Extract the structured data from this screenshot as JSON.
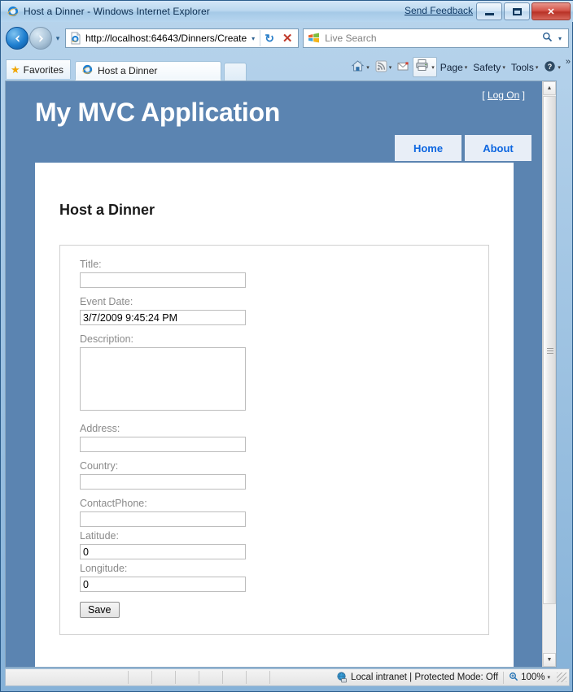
{
  "window": {
    "title": "Host a Dinner - Windows Internet Explorer",
    "send_feedback": "Send Feedback",
    "minimize_label": "Minimize",
    "maximize_label": "Maximize",
    "close_label": "Close",
    "ie_icon": "internet-explorer-icon"
  },
  "nav": {
    "back_label": "Back",
    "forward_label": "Forward",
    "back_glyph": "←",
    "forward_glyph": "→",
    "history_glyph": "▾",
    "address": {
      "url": "http://localhost:64643/Dinners/Create",
      "page_icon": "page-document-icon",
      "dropdown_glyph": "▾",
      "refresh_glyph": "↻",
      "refresh_label": "Refresh",
      "stop_glyph": "✕",
      "stop_label": "Stop"
    },
    "search": {
      "placeholder": "Live Search",
      "provider_icon": "windows-logo-icon",
      "magnifier_glyph": "⌕",
      "dropdown_glyph": "▾"
    }
  },
  "commandbar": {
    "favorites_label": "Favorites",
    "favorites_icon": "star-icon",
    "tab_label": "Host a Dinner",
    "tab_icon": "internet-explorer-icon",
    "new_tab_label": "New Tab",
    "items": [
      {
        "label": "",
        "icon": "home-icon",
        "caret": "▾"
      },
      {
        "label": "",
        "icon": "rss-feed-icon",
        "caret": "▾"
      },
      {
        "label": "",
        "icon": "mail-icon",
        "caret": ""
      },
      {
        "label": "",
        "icon": "printer-icon",
        "caret": "▾"
      },
      {
        "label": "Page",
        "icon": "",
        "caret": "▾"
      },
      {
        "label": "Safety",
        "icon": "",
        "caret": "▾"
      },
      {
        "label": "Tools",
        "icon": "",
        "caret": "▾"
      },
      {
        "label": "",
        "icon": "help-icon",
        "caret": "▾"
      }
    ],
    "overflow_glyph": "»"
  },
  "site": {
    "title": "My MVC Application",
    "logon_prefix": "[",
    "logon_label": "Log On",
    "logon_suffix": "]",
    "menu": [
      {
        "label": "Home"
      },
      {
        "label": "About"
      }
    ],
    "accent_bg": "#5B84B1",
    "menu_link_color": "#0d66e0"
  },
  "form": {
    "heading": "Host a Dinner",
    "fields": [
      {
        "label": "Title:",
        "value": "",
        "type": "text",
        "name": "title"
      },
      {
        "label": "Event Date:",
        "value": "3/7/2009 9:45:24 PM",
        "type": "text",
        "name": "event-date"
      },
      {
        "label": "Description:",
        "value": "",
        "type": "textarea",
        "name": "description"
      },
      {
        "label": "Address:",
        "value": "",
        "type": "text",
        "name": "address"
      },
      {
        "label": "Country:",
        "value": "",
        "type": "text",
        "name": "country"
      },
      {
        "label": "ContactPhone:",
        "value": "",
        "type": "text",
        "name": "contact-phone"
      },
      {
        "label": "Latitude:",
        "value": "0",
        "type": "text",
        "name": "latitude"
      },
      {
        "label": "Longitude:",
        "value": "0",
        "type": "text",
        "name": "longitude"
      }
    ],
    "save_label": "Save"
  },
  "scrollbar": {
    "up_glyph": "▲",
    "down_glyph": "▼"
  },
  "statusbar": {
    "zone_text": "Local intranet | Protected Mode: Off",
    "zone_icon": "globe-security-icon",
    "zoom_level": "100%",
    "zoom_icon": "magnifier-plus-icon",
    "zoom_caret": "▾"
  }
}
